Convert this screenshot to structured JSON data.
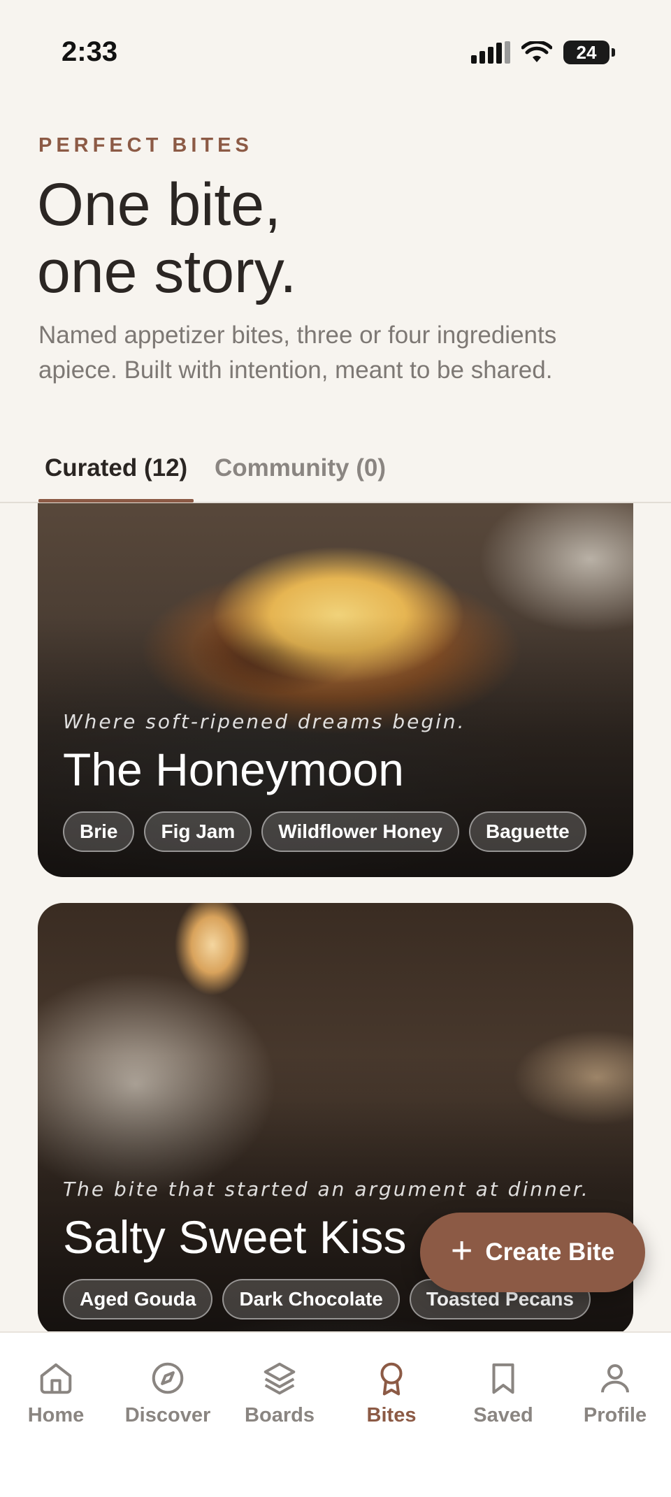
{
  "status_bar": {
    "time": "2:33",
    "battery": "24"
  },
  "header": {
    "eyebrow": "PERFECT BITES",
    "title_line1": "One bite,",
    "title_line2": "one story.",
    "subtitle": "Named appetizer bites, three or four ingredients apiece. Built with intention, meant to be shared."
  },
  "tabs": [
    {
      "label": "Curated (12)",
      "active": true
    },
    {
      "label": "Community (0)",
      "active": false
    }
  ],
  "cards": [
    {
      "tagline": "Where soft-ripened dreams begin.",
      "title": "The Honeymoon",
      "ingredients": [
        "Brie",
        "Fig Jam",
        "Wildflower Honey",
        "Baguette"
      ]
    },
    {
      "tagline": "The bite that started an argument at dinner.",
      "title": "Salty Sweet Kiss",
      "ingredients": [
        "Aged Gouda",
        "Dark Chocolate",
        "Toasted Pecans"
      ]
    }
  ],
  "fab": {
    "label": "Create Bite",
    "icon": "plus-icon"
  },
  "nav": [
    {
      "label": "Home",
      "icon": "home-icon",
      "active": false
    },
    {
      "label": "Discover",
      "icon": "compass-icon",
      "active": false
    },
    {
      "label": "Boards",
      "icon": "layers-icon",
      "active": false
    },
    {
      "label": "Bites",
      "icon": "award-icon",
      "active": true
    },
    {
      "label": "Saved",
      "icon": "bookmark-icon",
      "active": false
    },
    {
      "label": "Profile",
      "icon": "user-icon",
      "active": false
    }
  ],
  "colors": {
    "accent": "#8c5a45",
    "background": "#f7f4ef",
    "muted": "#8a8581"
  }
}
